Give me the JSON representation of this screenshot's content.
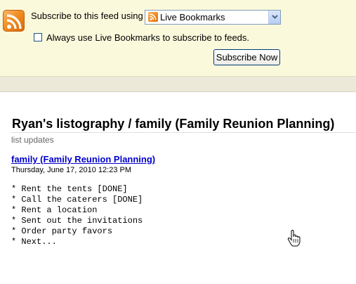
{
  "subscribe": {
    "label": "Subscribe to this feed using",
    "reader_value": "Live Bookmarks",
    "always_label": "Always use Live Bookmarks to subscribe to feeds.",
    "always_checked": false,
    "button_label": "Subscribe Now"
  },
  "feed": {
    "title": "Ryan's listography / family (Family Reunion Planning)",
    "subtitle": "list updates",
    "entries": [
      {
        "link": "family (Family Reunion Planning)",
        "date": "Thursday, June 17, 2010 12:23 PM",
        "lines": [
          "* Rent the tents [DONE]",
          "* Call the caterers [DONE]",
          "* Rent a location",
          "* Sent out the invitations",
          "* Order party favors",
          "* Next..."
        ]
      }
    ]
  },
  "colors": {
    "bar_background": "#fbf9dc",
    "strip_background": "#ece9d8",
    "feed_icon": "#f08a1e",
    "link": "#0000cc"
  },
  "icons": {
    "feed": "feed-icon",
    "dropdown": "chevron-down-icon",
    "cursor": "hand-pointer-icon"
  }
}
